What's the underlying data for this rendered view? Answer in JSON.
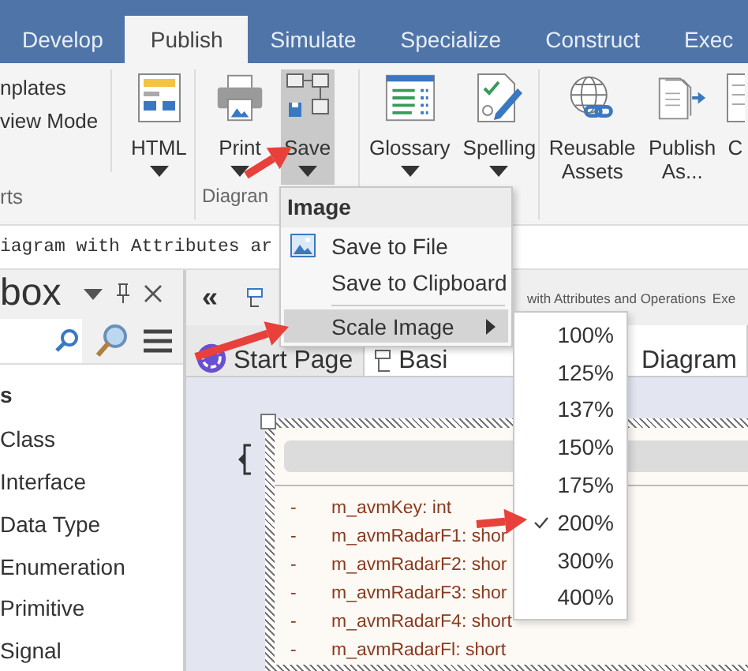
{
  "ribbon_tabs": [
    {
      "label": "Develop",
      "selected": false
    },
    {
      "label": "Publish",
      "selected": true
    },
    {
      "label": "Simulate",
      "selected": false
    },
    {
      "label": "Specialize",
      "selected": false
    },
    {
      "label": "Construct",
      "selected": false
    },
    {
      "label": "Exec",
      "selected": false
    }
  ],
  "ribbon_groups": [
    {
      "label": "rts",
      "small_items": [
        "nplates",
        "view Mode"
      ],
      "buttons": [
        {
          "label": "HTML",
          "dropdown": true,
          "pressed": false
        }
      ]
    },
    {
      "label": "Diagran",
      "buttons": [
        {
          "label": "Print",
          "dropdown": true,
          "pressed": false
        },
        {
          "label": "Save",
          "dropdown": true,
          "pressed": true
        }
      ]
    },
    {
      "buttons": [
        {
          "label": "Glossary",
          "dropdown": true,
          "pressed": false
        },
        {
          "label": "Spelling",
          "dropdown": true,
          "pressed": false
        }
      ]
    },
    {
      "buttons": [
        {
          "label": "Reusable Assets",
          "dropdown": false,
          "pressed": false
        },
        {
          "label": "Publish As...",
          "dropdown": false,
          "pressed": false
        },
        {
          "label": "C",
          "dropdown": false,
          "pressed": false
        }
      ]
    }
  ],
  "command_line": "iagram with Attributes ar",
  "toolbox": {
    "title": "box",
    "section": "s",
    "items": [
      "Class",
      "Interface",
      "Data Type",
      "Enumeration",
      "Primitive",
      "Signal"
    ]
  },
  "diagram_header": {
    "collapse_button": "«",
    "title": "with Attributes and Operations",
    "extra": "Exe"
  },
  "document_tabs": [
    {
      "label": "Start Page",
      "selected": false
    },
    {
      "label": "Basi",
      "label_end": "Diagram",
      "selected": true
    }
  ],
  "class_element": {
    "attributes": [
      {
        "visibility": "-",
        "text": "m_avmKey: int"
      },
      {
        "visibility": "-",
        "text": "m_avmRadarF1: shor"
      },
      {
        "visibility": "-",
        "text": "m_avmRadarF2: shor"
      },
      {
        "visibility": "-",
        "text": "m_avmRadarF3: shor"
      },
      {
        "visibility": "-",
        "text": "m_avmRadarF4: short"
      },
      {
        "visibility": "-",
        "text": "m_avmRadarFl: short"
      }
    ]
  },
  "context_menu": {
    "header": "Image",
    "items": [
      {
        "kind": "item",
        "label": "Save to File",
        "has_icon": true
      },
      {
        "kind": "item",
        "label": "Save to Clipboard",
        "has_icon": false
      },
      {
        "kind": "separator"
      },
      {
        "kind": "submenu",
        "label": "Scale Image",
        "selected": true
      }
    ]
  },
  "scale_submenu": {
    "items": [
      {
        "label": "100%",
        "checked": false
      },
      {
        "label": "125%",
        "checked": false
      },
      {
        "label": "137%",
        "checked": false
      },
      {
        "label": "150%",
        "checked": false
      },
      {
        "label": "175%",
        "checked": false
      },
      {
        "label": "200%",
        "checked": true
      },
      {
        "label": "300%",
        "checked": false
      },
      {
        "label": "400%",
        "checked": false
      }
    ]
  }
}
